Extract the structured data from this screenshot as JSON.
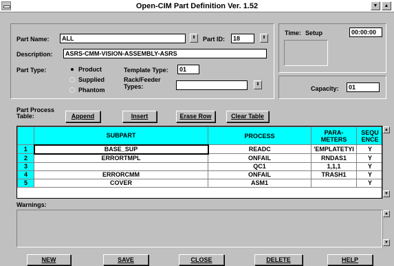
{
  "window": {
    "title": "Open-CIM  Part Definition  Ver. 1.52",
    "minimize_glyph": "▼",
    "maximize_glyph": "▲"
  },
  "form": {
    "part_name_label": "Part Name:",
    "part_name_value": "ALL",
    "part_id_label": "Part ID:",
    "part_id_value": "18",
    "description_label": "Description:",
    "description_value": "ASRS-CMM-VISION-ASSEMBLY-ASRS",
    "part_type_label": "Part Type:",
    "part_type_options": [
      "Product",
      "Supplied",
      "Phantom"
    ],
    "template_type_label": "Template Type:",
    "template_type_value": "01",
    "rack_feeder_label": "Rack/Feeder Types:",
    "rack_feeder_value": ""
  },
  "time": {
    "label": "Time:",
    "mode": "Setup",
    "value": "00:00:00"
  },
  "capacity": {
    "label": "Capacity:",
    "value": "01"
  },
  "process_table": {
    "label": "Part Process Table:",
    "buttons": [
      "Append",
      "Insert",
      "Erase Row",
      "Clear Table"
    ],
    "headers": [
      "SUBPART",
      "PROCESS",
      "PARA-\nMETERS",
      "SEQU\nENCE"
    ],
    "rows": [
      [
        "1",
        "BASE_SUP",
        "READC",
        "'EMPLATETYI",
        "Y"
      ],
      [
        "2",
        "ERRORTMPL",
        "ONFAIL",
        "RNDAS1",
        "Y"
      ],
      [
        "3",
        "",
        "QC1",
        "1,1,1",
        "Y"
      ],
      [
        "4",
        "ERRORCMM",
        "ONFAIL",
        "TRASH1",
        "Y"
      ],
      [
        "5",
        "COVER",
        "ASM1",
        "",
        "Y"
      ]
    ]
  },
  "warnings": {
    "label": "Warnings:",
    "text": ""
  },
  "footer_buttons": [
    "NEW",
    "SAVE",
    "CLOSE",
    "DELETE",
    "HELP"
  ],
  "icons": {
    "spin": "⇕",
    "scroll_up": "▲",
    "scroll_down": "▼"
  }
}
